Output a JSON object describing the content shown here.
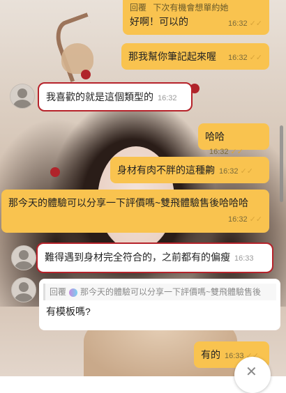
{
  "messages": {
    "m1": {
      "reply_label": "回覆",
      "reply_snippet": "下次有機會想單約她",
      "text": "好啊！可以的",
      "time": "16:32"
    },
    "m2": {
      "text": "那我幫你筆記起來喔",
      "time": "16:32"
    },
    "m3": {
      "text": "我喜歡的就是這個類型的",
      "time": "16:32"
    },
    "m4": {
      "text": "哈哈",
      "time": "16:32"
    },
    "m5": {
      "text": "身材有肉不胖的這種齁",
      "time": "16:32"
    },
    "m6": {
      "text": "那今天的體驗可以分享一下評價嗎~雙飛體驗售後哈哈哈",
      "time": "16:32"
    },
    "m7": {
      "text": "難得遇到身材完全符合的，之前都有的偏瘦",
      "time": "16:33"
    },
    "m8": {
      "reply_label": "回覆",
      "reply_snippet": "那今天的體驗可以分享一下評價嗎~雙飛體驗售後",
      "text": "有模板嗎?",
      "time": ""
    },
    "m9": {
      "text": "有的",
      "time": "16:33"
    }
  },
  "icons": {
    "read": "double-check-icon",
    "fab": "close-icon"
  },
  "colors": {
    "outgoing": "#f9c34f",
    "incoming": "#ffffff",
    "highlight": "#b6222a"
  }
}
